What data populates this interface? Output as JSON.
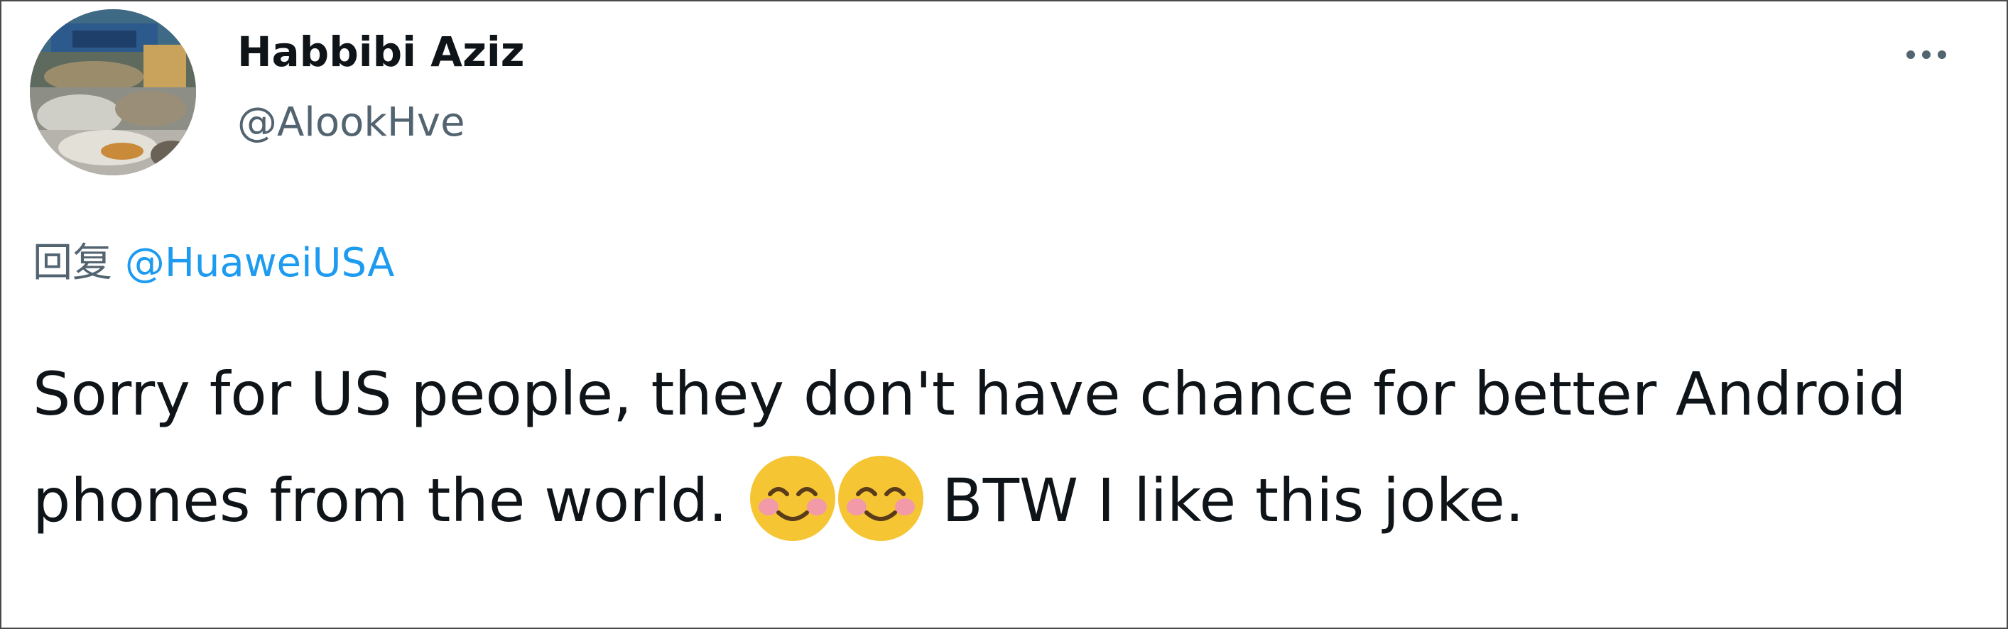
{
  "author": {
    "display_name": "Habbibi Aziz",
    "handle": "@AlookHve",
    "avatar_icon": "profile-photo"
  },
  "reply": {
    "prefix": "回复",
    "target": "@HuaweiUSA"
  },
  "tweet": {
    "text_part1": "Sorry for US people, they don't have chance for better Android phones from the world.",
    "emojis": [
      "smiling-face-with-smiling-eyes",
      "smiling-face-with-smiling-eyes"
    ],
    "text_part2": "BTW I like this joke."
  },
  "more_icon": "more-horizontal-icon",
  "colors": {
    "link": "#1d9bf0",
    "secondary_text": "#536471",
    "primary_text": "#0f1419",
    "border": "#4a4a4a"
  }
}
